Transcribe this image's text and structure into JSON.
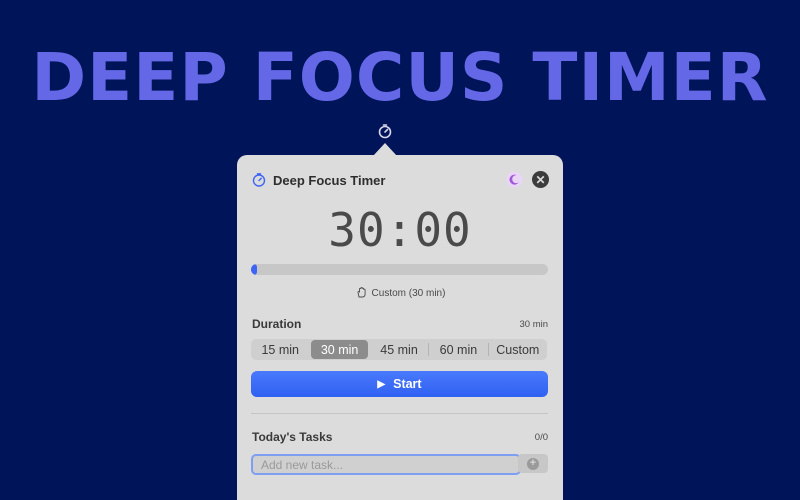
{
  "hero": {
    "title": "DEEP FOCUS TIMER"
  },
  "colors": {
    "background": "#00145a",
    "hero_text": "#6468e6",
    "accent": "#3d64f5",
    "panel": "#dcdcdc",
    "moon_icon": "#a259d9"
  },
  "menubar": {
    "icon": "timer-icon"
  },
  "popover": {
    "header": {
      "icon": "timer-icon",
      "title": "Deep Focus Timer",
      "theme_icon": "moon-icon",
      "close_icon": "close-icon",
      "close_glyph": "✕"
    },
    "timer": {
      "display": "30:00",
      "progress": 0.0
    },
    "mode": {
      "icon": "hand-icon",
      "label": "Custom (30 min)"
    },
    "duration": {
      "label": "Duration",
      "value": "30 min",
      "options": [
        "15 min",
        "30 min",
        "45 min",
        "60 min",
        "Custom"
      ],
      "selected": "30 min"
    },
    "start_button": {
      "icon": "play-icon",
      "icon_glyph": "▶",
      "label": "Start"
    },
    "tasks": {
      "label": "Today's Tasks",
      "count": "0/0",
      "input_placeholder": "Add new task...",
      "input_value": "",
      "add_icon": "plus-icon",
      "add_glyph": "+"
    }
  }
}
